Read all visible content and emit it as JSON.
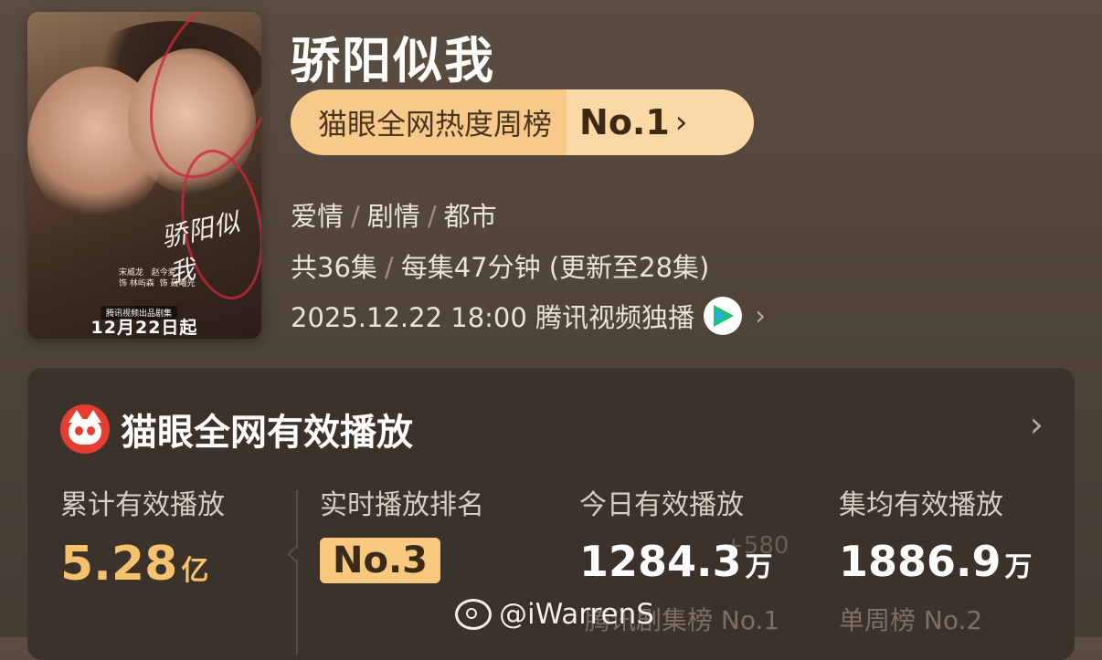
{
  "poster": {
    "title_art": "骄阳似我",
    "cast_left": "宋威龙",
    "cast_left_role": "饰 林屿森",
    "cast_right": "赵今麦",
    "cast_right_role": "饰 聂曦光",
    "strip": "腾讯视频出品剧集",
    "date": "12月22日起"
  },
  "show": {
    "title": "骄阳似我",
    "rank_label": "猫眼全网热度周榜",
    "rank_value": "No.1",
    "rank_chevron": "›",
    "tags": [
      "爱情",
      "剧情",
      "都市"
    ],
    "tag_sep": "/",
    "episodes_total": "共36集",
    "episode_length": "每集47分钟 (更新至28集)",
    "airing": "2025.12.22 18:00 腾讯视频独播",
    "airing_chevron": "›"
  },
  "card": {
    "title": "猫眼全网有效播放",
    "chevron": "›",
    "stats": {
      "cumulative_label": "累计有效播放",
      "cumulative_value": "5.28",
      "cumulative_unit": "亿",
      "realtime_label": "实时播放排名",
      "realtime_value": "No.3",
      "today_label": "今日有效播放",
      "today_value": "1284.3",
      "today_unit": "万",
      "today_faint": "+580",
      "today_sub": "腾讯剧集榜 No.1",
      "avg_label": "集均有效播放",
      "avg_value": "1886.9",
      "avg_unit": "万",
      "avg_sub": "单周榜 No.2"
    }
  },
  "watermark": "@iWarrenS",
  "colors": {
    "accent_gold": "#f5c36e",
    "pill_bg": "#fbd9a6",
    "logo_red": "#e53d30",
    "tencent_green": "#1ec275"
  }
}
